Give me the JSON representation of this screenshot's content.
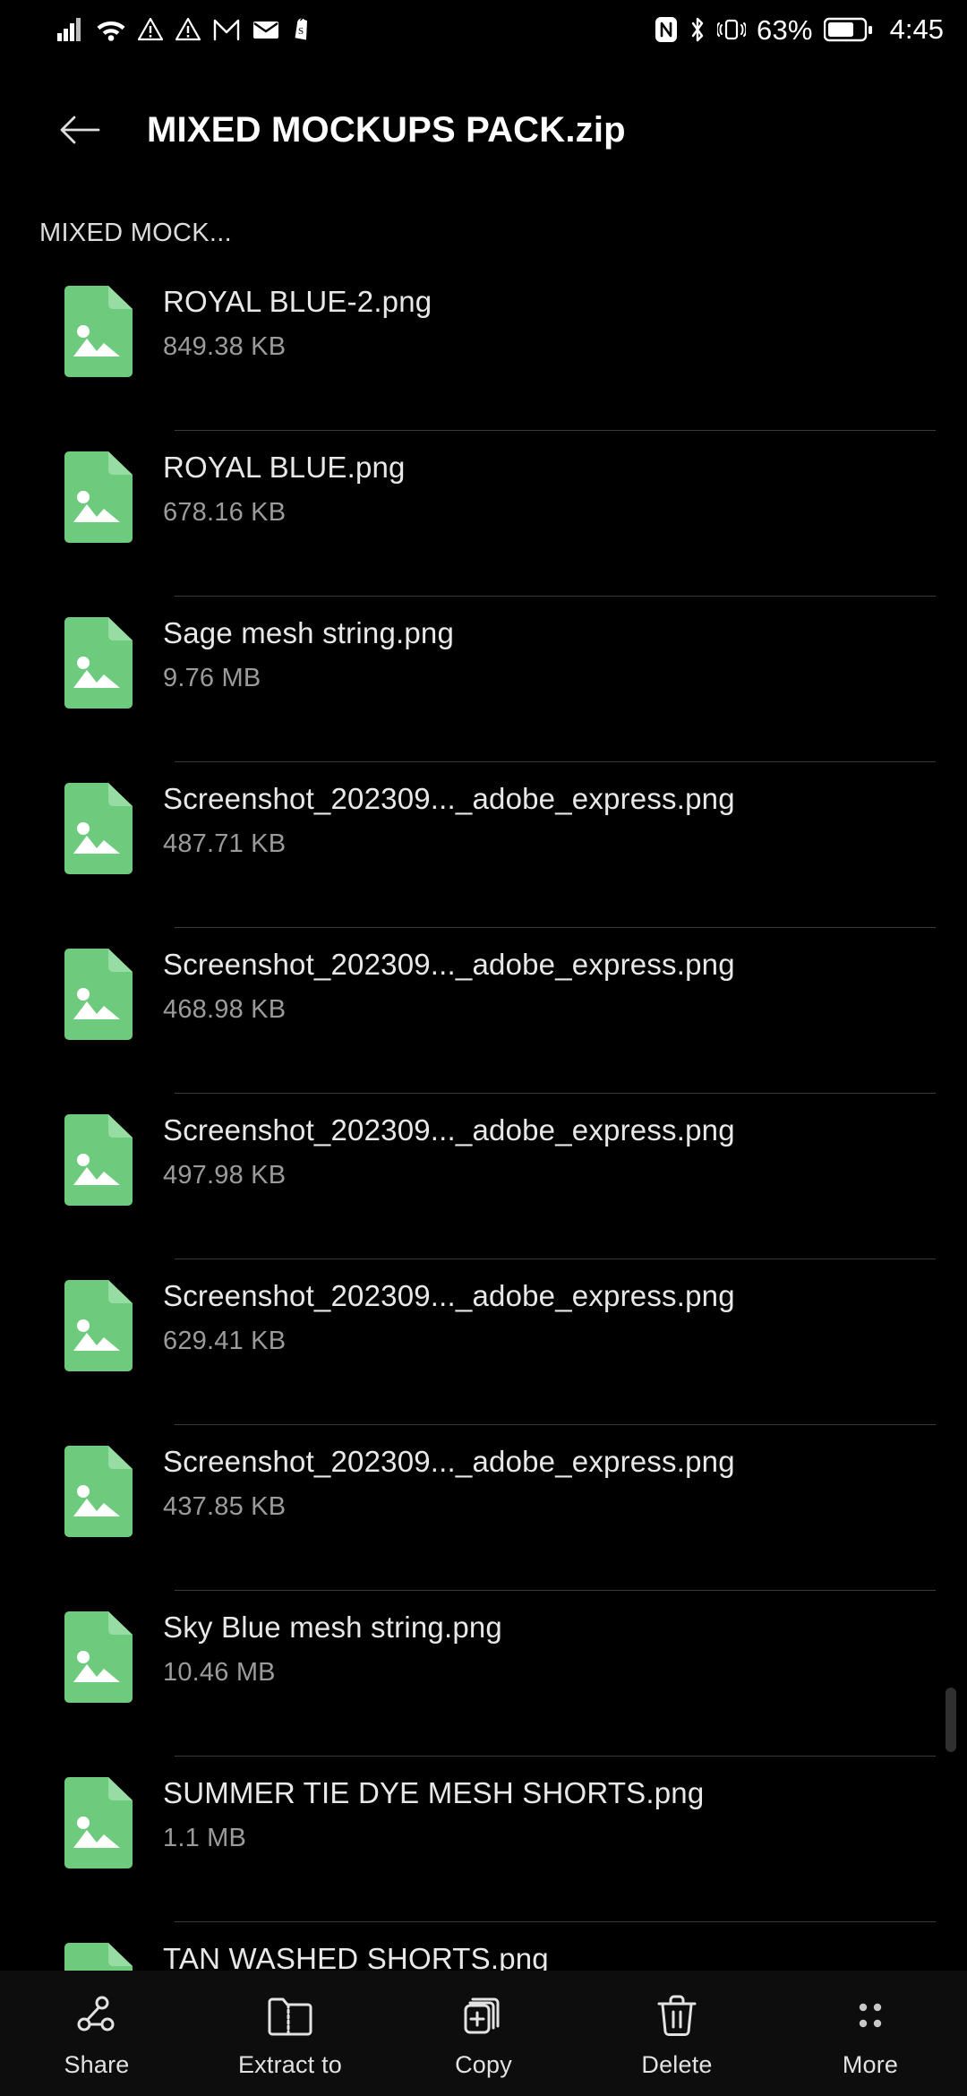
{
  "status_bar": {
    "left_icons": [
      "signal-bars-icon",
      "wifi-icon",
      "warning-triangle-icon",
      "warning-triangle-icon",
      "gmail-icon",
      "mail-icon",
      "shopify-icon"
    ],
    "right_icons": [
      "nfc-icon",
      "bluetooth-icon",
      "vibrate-icon",
      "battery-icon"
    ],
    "battery_percent": "63%",
    "time": "4:45"
  },
  "header": {
    "back_icon": "back-arrow-icon",
    "title": "MIXED MOCKUPS PACK.zip"
  },
  "breadcrumb": {
    "label": "MIXED MOCK..."
  },
  "colors": {
    "file_icon_green": "#6ECB7D",
    "file_icon_fold": "#97DCA2",
    "background": "#000000",
    "bottom_bar": "#0D0D0D",
    "divider": "#3A3A3A",
    "filename": "#E8E8E8",
    "filesize": "#9B9B9B"
  },
  "file_list": {
    "items": [
      {
        "name": "ROYAL BLUE-2.png",
        "size": "849.38 KB",
        "icon": "image-file-icon"
      },
      {
        "name": "ROYAL BLUE.png",
        "size": "678.16 KB",
        "icon": "image-file-icon"
      },
      {
        "name": "Sage mesh string.png",
        "size": "9.76 MB",
        "icon": "image-file-icon"
      },
      {
        "name": "Screenshot_202309..._adobe_express.png",
        "size": "487.71 KB",
        "icon": "image-file-icon"
      },
      {
        "name": "Screenshot_202309..._adobe_express.png",
        "size": "468.98 KB",
        "icon": "image-file-icon"
      },
      {
        "name": "Screenshot_202309..._adobe_express.png",
        "size": "497.98 KB",
        "icon": "image-file-icon"
      },
      {
        "name": "Screenshot_202309..._adobe_express.png",
        "size": "629.41 KB",
        "icon": "image-file-icon"
      },
      {
        "name": "Screenshot_202309..._adobe_express.png",
        "size": "437.85 KB",
        "icon": "image-file-icon"
      },
      {
        "name": "Sky Blue mesh string.png",
        "size": "10.46 MB",
        "icon": "image-file-icon"
      },
      {
        "name": "SUMMER TIE DYE MESH SHORTS.png",
        "size": "1.1 MB",
        "icon": "image-file-icon"
      },
      {
        "name": "TAN WASHED SHORTS.png",
        "size": "",
        "icon": "image-file-icon"
      }
    ]
  },
  "bottom_bar": {
    "actions": [
      {
        "label": "Share",
        "icon": "share-nodes-icon"
      },
      {
        "label": "Extract to",
        "icon": "zip-folder-icon"
      },
      {
        "label": "Copy",
        "icon": "copy-plus-icon"
      },
      {
        "label": "Delete",
        "icon": "trash-icon"
      },
      {
        "label": "More",
        "icon": "more-dots-icon"
      }
    ]
  }
}
